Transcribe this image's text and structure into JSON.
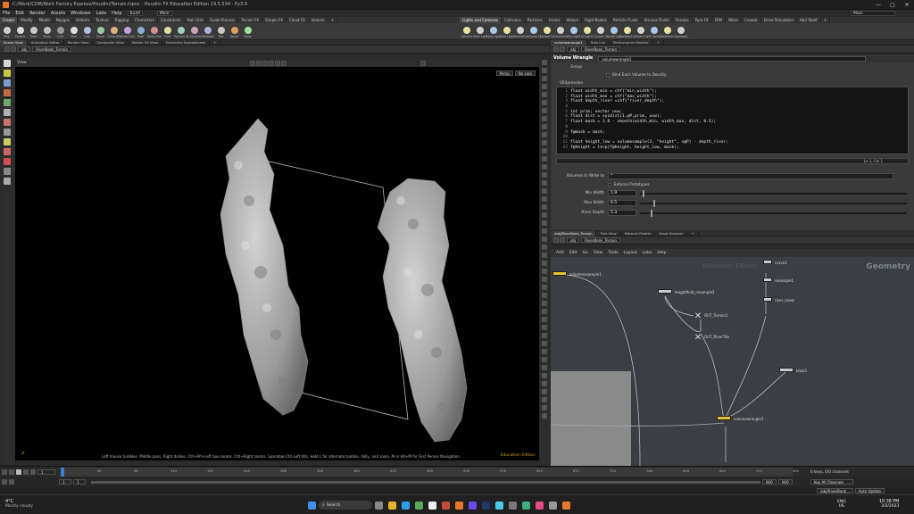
{
  "window": {
    "title": "C:/Work/CDM/Work Factory Express/Houdini/Terrain.hipnc - Houdini FX Education Edition 19.5.534 - Py3.9",
    "controls": [
      "—",
      "▢",
      "✕"
    ]
  },
  "menubar": {
    "items": [
      "File",
      "Edit",
      "Render",
      "Assets",
      "Windows",
      "Labs",
      "Help"
    ],
    "build_dropdown": "Build",
    "desk_dropdown": "Main"
  },
  "shelf_left": {
    "tabs": [
      "Create",
      "Modify",
      "Model",
      "Polygon",
      "Deform",
      "Texture",
      "Rigging",
      "Characters",
      "Constraints",
      "Hair Utils",
      "Guide Process",
      "Terrain FX",
      "Simple FX",
      "Cloud FX",
      "Volume",
      "+"
    ],
    "tools": [
      "Box",
      "Sphere",
      "Tube",
      "Torus",
      "Grid",
      "Null",
      "Line",
      "Circle",
      "Curve Bezier",
      "Draw Curve",
      "Path",
      "Spray Paint",
      "Font",
      "Platonic Solids",
      "L-System",
      "Metaball",
      "File",
      "Spiral",
      "Helix"
    ]
  },
  "shelf_right": {
    "tabs": [
      "Lights and Cameras",
      "Collisions",
      "Particles",
      "Grains",
      "Vellum",
      "Rigid Bodies",
      "Particle Fluids",
      "Viscous Fluids",
      "Oceans",
      "Pyro FX",
      "FEM",
      "Wires",
      "Crowds",
      "Drive Simulation",
      "Hair Shelf",
      "+"
    ],
    "tools": [
      "Camera",
      "Point Light",
      "Spot Light",
      "Area Light",
      "Geometry Light",
      "Volume Light",
      "Distant Light",
      "Environment Light",
      "Sky Light",
      "GI Light",
      "Caustic Light",
      "Portal Light",
      "Ambient Light",
      "Stereo Camera",
      "VR Camera",
      "Switcher",
      "Gamepad Camera"
    ]
  },
  "viewport_pane": {
    "tabs": [
      "Scene View",
      "Animation Editor",
      "Render View",
      "Composite View",
      "Motion FX View",
      "Geometry Spreadsheet",
      "+"
    ],
    "path": [
      "obj",
      "RiverBank_Terrain"
    ],
    "header_label": "View",
    "persp_button": "Persp",
    "cam_button": "No cam",
    "hint": "Left mouse tumbles. Middle pans. Right dollies. Ctrl+Alt+Left box-zooms. Ctrl+Right zooms. Spacebar-Ctrl-Left tilts. Hold L for alternate tumble, dolly, and zoom.   M or Alt+M for First Person Navigation.",
    "watermark": "Education Edition"
  },
  "param_pane": {
    "tabs": [
      "volumewrangle1",
      "Take List",
      "Performance Monitor",
      "+"
    ],
    "path": [
      "obj",
      "RiverBank_Terrain"
    ],
    "node_type": "Volume Wrangle",
    "node_name": "volumewrangle1",
    "group_label": "Group",
    "bind_label": "Bind Each Volume to Density",
    "vex_label": "VEXpression",
    "code": [
      "float width_min = chf(\"min_width\");",
      "float width_max = chf(\"max_width\");",
      "float depth_river =chf(\"river_depth\");",
      "",
      "int prim; vector uvw;",
      "float dist = xyzdist(1,@P,prim, uvw);",
      "float mask = 1.0 - smooth(width_min, width_max, dist, 0.5);",
      "",
      "f@mask = mask;",
      "",
      "float height_low = volumesample(2, \"height\", v@P) - depth_river;",
      "f@height = lerp(f@height, height_low, mask);"
    ],
    "cursor_pos": "Ln 1, Col 1",
    "volumes_label": "Volumes to Write to",
    "volumes_value": "*",
    "enforce_label": "Enforce Prototypes",
    "params": [
      {
        "label": "Min Width",
        "value": "1.9",
        "fill": 0.01
      },
      {
        "label": "Max Width",
        "value": "6.5",
        "fill": 0.05
      },
      {
        "label": "River Depth",
        "value": "5.3",
        "fill": 0.04
      }
    ]
  },
  "network_pane": {
    "tabs": [
      "/obj/RiverBank_Terrain",
      "Tree View",
      "Material Palette",
      "Asset Browser",
      "+"
    ],
    "path": [
      "obj",
      "RiverBank_Terrain"
    ],
    "menu": [
      "Add",
      "Edit",
      "Go",
      "View",
      "Tools",
      "Layout",
      "Labs",
      "Help"
    ],
    "context_label": "Geometry",
    "watermark": "Education Edition",
    "nodes": [
      {
        "name": "volumeresample1"
      },
      {
        "name": "heightfield_resample2"
      },
      {
        "name": "curve1"
      },
      {
        "name": "resample1"
      },
      {
        "name": "river_mask"
      },
      {
        "name": "OUT_Terrain1"
      },
      {
        "name": "OUT_RiverTile"
      },
      {
        "name": "blast1"
      },
      {
        "name": "volumewrangle1"
      }
    ]
  },
  "timeline": {
    "frame": "1",
    "ticks": [
      "1",
      "48",
      "96",
      "144",
      "192",
      "240",
      "288",
      "336",
      "384",
      "432",
      "480",
      "528",
      "576",
      "624",
      "672",
      "720",
      "768",
      "816",
      "864",
      "912",
      "960"
    ],
    "start": "1",
    "start2": "1",
    "end": "960",
    "end2": "960",
    "keys_label": "0 keys, 0/0 channels",
    "key_all": "Key All Channels",
    "node_path": "/obj/RiverBank...",
    "auto_update": "Auto Update"
  },
  "taskbar": {
    "weather_temp": "4°C",
    "weather_text": "Mostly cloudy",
    "search": "Search",
    "lang": "ENG",
    "region": "US",
    "time": "10:38 PM",
    "date": "3/2/2023"
  }
}
